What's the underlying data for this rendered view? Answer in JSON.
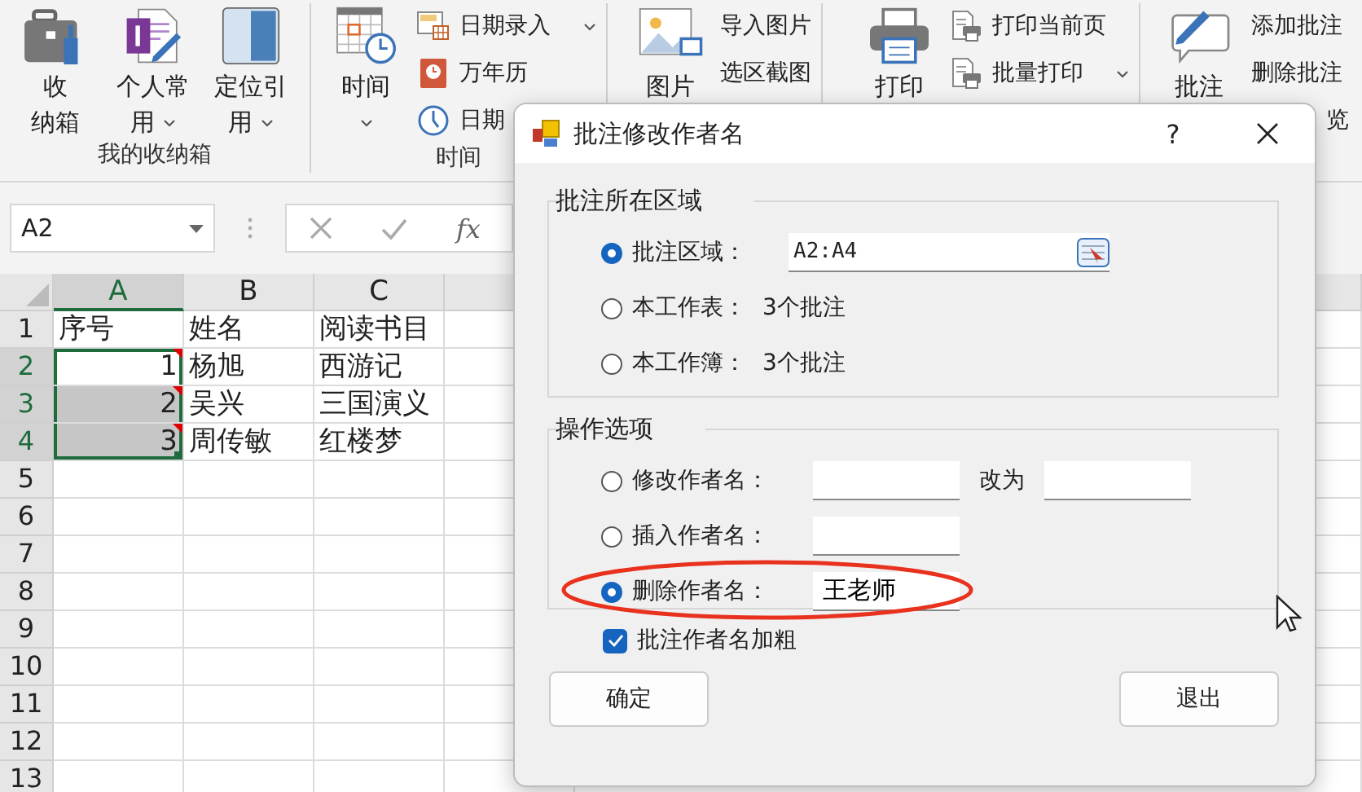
{
  "ribbon": {
    "groups": [
      {
        "label": "我的收纳箱",
        "large": [
          {
            "lines": [
              "收",
              "纳箱"
            ],
            "dropdown": false
          },
          {
            "lines": [
              "个人常",
              "用"
            ],
            "dropdown": true
          },
          {
            "lines": [
              "定位引",
              "用"
            ],
            "dropdown": true
          }
        ]
      },
      {
        "label": "时间",
        "large": [
          {
            "lines": [
              "时间"
            ],
            "dropdown": true
          }
        ],
        "small": [
          {
            "label": "日期录入",
            "dropdown": true
          },
          {
            "label": "万年历",
            "dropdown": false
          },
          {
            "label": "日期",
            "dropdown": false
          }
        ]
      },
      {
        "large": [
          {
            "lines": [
              "图片"
            ],
            "dropdown": false
          }
        ],
        "small": [
          {
            "label": "导入图片",
            "dropdown": false
          },
          {
            "label": "选区截图",
            "dropdown": false
          }
        ]
      },
      {
        "large": [
          {
            "lines": [
              "打印"
            ],
            "dropdown": false
          }
        ],
        "small": [
          {
            "label": "打印当前页",
            "dropdown": false
          },
          {
            "label": "批量打印",
            "dropdown": true
          }
        ]
      },
      {
        "large": [
          {
            "lines": [
              "批注"
            ],
            "dropdown": false
          }
        ],
        "small": [
          {
            "label": "添加批注",
            "dropdown": false
          },
          {
            "label": "删除批注",
            "dropdown": false
          },
          {
            "label": "览",
            "dropdown": false
          }
        ]
      }
    ]
  },
  "formula_bar": {
    "name_box": "A2",
    "fx": "fx"
  },
  "sheet": {
    "columns": [
      {
        "label": "A",
        "selected": true
      },
      {
        "label": "B",
        "selected": false
      },
      {
        "label": "C",
        "selected": false
      }
    ],
    "rows": [
      {
        "label": "1",
        "selected": false,
        "cells": [
          {
            "text": "序号",
            "kind": "text",
            "selected": false,
            "comment": false
          },
          {
            "text": "姓名",
            "kind": "text",
            "selected": false,
            "comment": false
          },
          {
            "text": "阅读书目",
            "kind": "text",
            "selected": false,
            "comment": false
          }
        ]
      },
      {
        "label": "2",
        "selected": true,
        "cells": [
          {
            "text": "1",
            "kind": "number",
            "selected": true,
            "comment": true
          },
          {
            "text": "杨旭",
            "kind": "text",
            "selected": false,
            "comment": false
          },
          {
            "text": "西游记",
            "kind": "text",
            "selected": false,
            "comment": false
          }
        ]
      },
      {
        "label": "3",
        "selected": true,
        "cells": [
          {
            "text": "2",
            "kind": "number",
            "selected": true,
            "comment": true
          },
          {
            "text": "吴兴",
            "kind": "text",
            "selected": false,
            "comment": false
          },
          {
            "text": "三国演义",
            "kind": "text",
            "selected": false,
            "comment": false
          }
        ]
      },
      {
        "label": "4",
        "selected": true,
        "cells": [
          {
            "text": "3",
            "kind": "number",
            "selected": true,
            "comment": true
          },
          {
            "text": "周传敏",
            "kind": "text",
            "selected": false,
            "comment": false
          },
          {
            "text": "红楼梦",
            "kind": "text",
            "selected": false,
            "comment": false
          }
        ]
      },
      {
        "label": "5",
        "selected": false
      },
      {
        "label": "6",
        "selected": false
      },
      {
        "label": "7",
        "selected": false
      },
      {
        "label": "8",
        "selected": false
      },
      {
        "label": "9",
        "selected": false
      },
      {
        "label": "10",
        "selected": false
      },
      {
        "label": "11",
        "selected": false
      },
      {
        "label": "12",
        "selected": false
      },
      {
        "label": "13",
        "selected": false
      }
    ]
  },
  "dialog": {
    "title": "批注修改作者名",
    "help": "?",
    "scope": {
      "title": "批注所在区域",
      "options": [
        {
          "kind": "range",
          "label": "批注区域：",
          "value": "A2:A4",
          "selected": true
        },
        {
          "kind": "info",
          "label": "本工作表：",
          "info": "3个批注",
          "selected": false
        },
        {
          "kind": "info",
          "label": "本工作簿：",
          "info": "3个批注",
          "selected": false
        }
      ]
    },
    "operation": {
      "title": "操作选项",
      "options": [
        {
          "kind": "rename",
          "label": "修改作者名：",
          "connector": "改为",
          "selected": false,
          "annotated": false
        },
        {
          "kind": "insert",
          "label": "插入作者名：",
          "selected": false,
          "annotated": false
        },
        {
          "kind": "delete",
          "label": "删除作者名：",
          "value": "王老师",
          "selected": true,
          "annotated": true
        }
      ]
    },
    "bold_checkbox": {
      "label": "批注作者名加粗",
      "checked": true
    },
    "buttons": [
      "确定",
      "退出"
    ]
  }
}
